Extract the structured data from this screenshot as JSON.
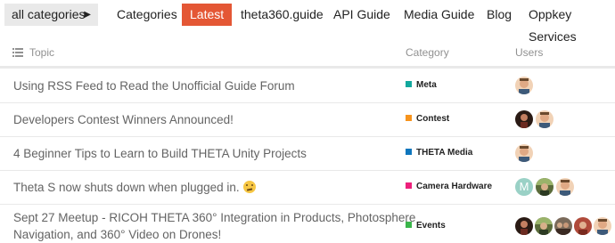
{
  "nav": {
    "category_dropdown": "all categories",
    "items": [
      "Categories",
      "Latest",
      "theta360.guide",
      "API Guide",
      "Media Guide",
      "Blog",
      "Oppkey Services"
    ],
    "active": "Latest"
  },
  "table_header": {
    "topic": "Topic",
    "category": "Category",
    "users": "Users"
  },
  "topics": [
    {
      "title": "Using RSS Feed to Read the Unofficial Guide Forum",
      "category": "Meta",
      "category_color": "#12a89d",
      "users": [
        "avatar-man"
      ]
    },
    {
      "title": "Developers Contest Winners Announced!",
      "category": "Contest",
      "category_color": "#f7941d",
      "users": [
        "avatar-dark",
        "avatar-man"
      ]
    },
    {
      "title": "4 Beginner Tips to Learn to Build THETA Unity Projects",
      "category": "THETA Media",
      "category_color": "#0e76bd",
      "users": [
        "avatar-man"
      ]
    },
    {
      "title": "Theta S now shuts down when plugged in.",
      "emoji": "confused-face",
      "category": "Camera Hardware",
      "category_color": "#ed207b",
      "users": [
        "avatar-letter-M",
        "avatar-outdoor",
        "avatar-man"
      ]
    },
    {
      "title_line1": "Sept 27 Meetup - RICOH THETA 360° Integration in Products, Photosphere",
      "title_line2": "Navigation, and 360° Video on Drones!",
      "category": "Events",
      "category_color": "#3ab54a",
      "users": [
        "avatar-dark",
        "avatar-outdoor",
        "avatar-group",
        "avatar-red",
        "avatar-man"
      ]
    }
  ],
  "avatar_letter": "M"
}
